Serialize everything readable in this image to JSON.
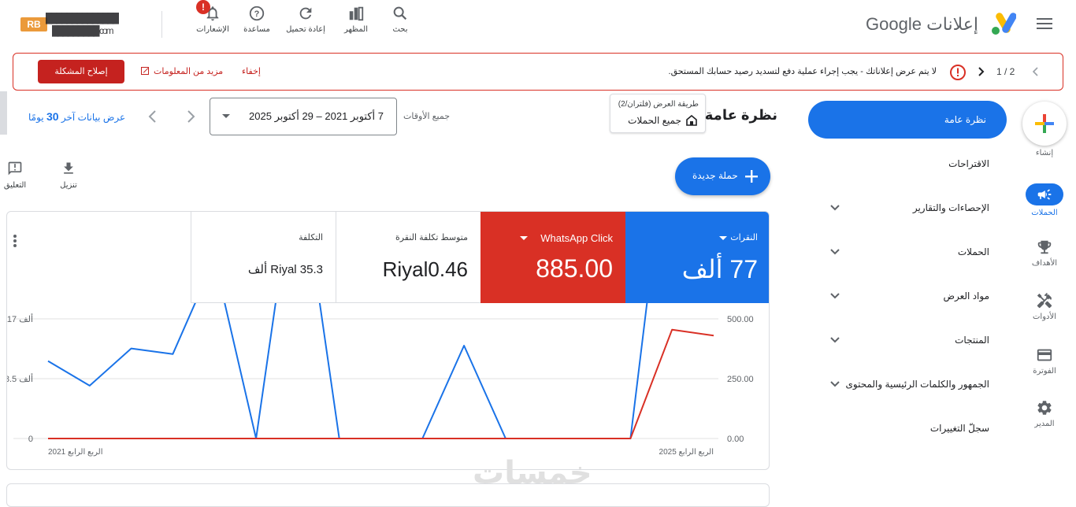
{
  "header": {
    "product_name": "إعلانات Google",
    "account_line1": "██████████████",
    "account_line2": "█████████.com",
    "buttons": {
      "search": "بحث",
      "appearance": "المظهر",
      "reload": "إعادة تحميل",
      "help": "مساعدة",
      "notifications": "الإشعارات"
    },
    "notification_badge": "!"
  },
  "alert": {
    "pager": "1 / 2",
    "message": "لا يتم عرض إعلاناتك - يجب إجراء عملية دفع لتسديد رصيد حسابك المستحق.",
    "dismiss": "إخفاء",
    "learn_more": "مزيد من المعلومات",
    "fix_button": "إصلاح المشكلة"
  },
  "rail": {
    "create": "إنشاء",
    "campaigns": "الحملات",
    "goals": "الأهداف",
    "tools": "الأدوات",
    "billing": "الفوترة",
    "admin": "المدير"
  },
  "nav": {
    "overview": "نظرة عامة",
    "items": [
      "الاقتراحات",
      "الإحصاءات والتقارير",
      "الحملات",
      "مواد العرض",
      "المنتجات",
      "الجمهور والكلمات الرئيسية والمحتوى",
      "سجلّ التغييرات"
    ]
  },
  "toolbar": {
    "page_title": "نظرة عامة",
    "view_filter_label": "طريقة العرض (فلتران/2)",
    "view_filter_value": "جميع الحملات",
    "all_time_label": "جميع الأوقات",
    "date_range": "7 أكتوبر 2021 – 29 أكتوبر 2025",
    "last_days_prefix": "عرض بيانات آخر",
    "last_days_number": "30",
    "last_days_suffix": "يومًا",
    "new_campaign": "حملة جديدة",
    "download": "تنزيل",
    "comment": "التعليق"
  },
  "metrics": [
    {
      "label": "النقرات",
      "value": "77 ألف",
      "color": "#1a73e8"
    },
    {
      "label": "WhatsApp Click",
      "value": "885.00",
      "color": "#d93025"
    },
    {
      "label": "متوسط تكلفة النقرة",
      "value": "Riyal0.46",
      "color": "#ffffff"
    },
    {
      "label": "التكلفة",
      "value": "Riyal 35.3 ألف",
      "color": "#ffffff"
    }
  ],
  "chart_data": {
    "type": "line",
    "x_start_label": "الربع الرابع 2021",
    "x_end_label": "الربع الرابع 2025",
    "left_axis_ticks": [
      "0",
      "8.5 ألف",
      "17 ألف"
    ],
    "right_axis_ticks": [
      "0.00",
      "250.00",
      "500.00"
    ],
    "ylim_left": [
      0,
      17000
    ],
    "ylim_right": [
      0,
      500
    ],
    "series": [
      {
        "axis": "left",
        "color": "#1a73e8",
        "values": [
          11000,
          7500,
          12800,
          12000,
          25500,
          0,
          41000,
          0,
          0,
          0,
          13200,
          0,
          0,
          0,
          0,
          48500,
          49500
        ]
      },
      {
        "axis": "right",
        "color": "#d93025",
        "values": [
          0,
          0,
          0,
          0,
          0,
          0,
          0,
          0,
          0,
          0,
          0,
          0,
          0,
          0,
          0,
          455,
          430
        ]
      }
    ]
  },
  "watermark": "خمسات"
}
